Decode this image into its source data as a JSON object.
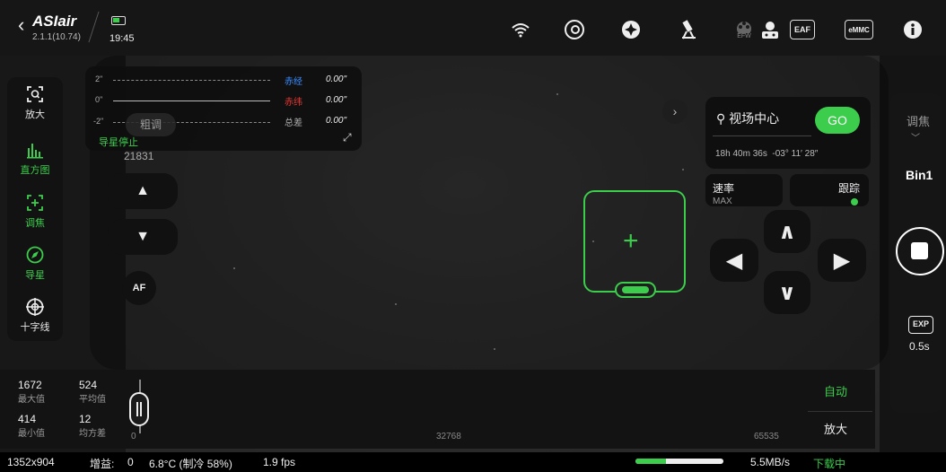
{
  "app": {
    "logo": "ASIair",
    "version": "2.1.1(10.74)",
    "time": "19:45"
  },
  "top_icons": [
    {
      "name": "wifi-icon"
    },
    {
      "name": "camera-icon"
    },
    {
      "name": "guide-scope-icon"
    },
    {
      "name": "telescope-mount-icon"
    },
    {
      "name": "filter-wheel-icon",
      "label": "EFW"
    },
    {
      "name": "rotator-icon"
    },
    {
      "name": "focuser-icon",
      "label": "EAF"
    },
    {
      "name": "storage-icon",
      "label": "eMMC"
    },
    {
      "name": "info-icon"
    }
  ],
  "left_tools": [
    {
      "label": "放大",
      "icon": "zoom-icon",
      "active": false
    },
    {
      "label": "直方图",
      "icon": "histogram-icon",
      "active": true
    },
    {
      "label": "调焦",
      "icon": "focus-icon",
      "active": true
    },
    {
      "label": "导星",
      "icon": "guiding-icon",
      "active": true
    },
    {
      "label": "十字线",
      "icon": "crosshair-icon",
      "active": false
    }
  ],
  "guide": {
    "scale": [
      "2\"",
      "0\"",
      "-2\""
    ],
    "ra_label": "赤经",
    "ra_value": "0.00\"",
    "dec_label": "赤纬",
    "dec_value": "0.00\"",
    "total_label": "总差",
    "total_value": "0.00\"",
    "coarse_label": "粗调",
    "status": "导星停止"
  },
  "focus": {
    "position": "21831",
    "af_label": "AF"
  },
  "goto": {
    "target": "视场中心",
    "go_label": "GO",
    "ra": "18h 40m 36s",
    "dec": "-03° 11′ 28″"
  },
  "mount": {
    "rate_label": "速率",
    "rate_value": "MAX",
    "tracking_label": "跟踪"
  },
  "right_panel": {
    "focus_tab": "调焦",
    "bin": "Bin1",
    "exp_label": "EXP",
    "exposure": "0.5s"
  },
  "histogram": {
    "stats": [
      {
        "value": "1672",
        "label": "最大值"
      },
      {
        "value": "524",
        "label": "平均值"
      },
      {
        "value": "414",
        "label": "最小值"
      },
      {
        "value": "12",
        "label": "均方差"
      }
    ],
    "ticks": [
      "0",
      "32768",
      "65535"
    ],
    "auto_label": "自动",
    "zoom_label": "放大"
  },
  "status_bar": {
    "resolution": "1352x904",
    "gain_label": "增益:",
    "gain_value": "0",
    "temperature": "6.8°C (制冷 58%)",
    "fps": "1.9 fps",
    "download_progress": 0.35,
    "speed": "5.5MB/s",
    "download_label": "下载中"
  },
  "colors": {
    "accent": "#3ccd4c",
    "ra": "#3b8cff",
    "dec": "#e53935"
  }
}
